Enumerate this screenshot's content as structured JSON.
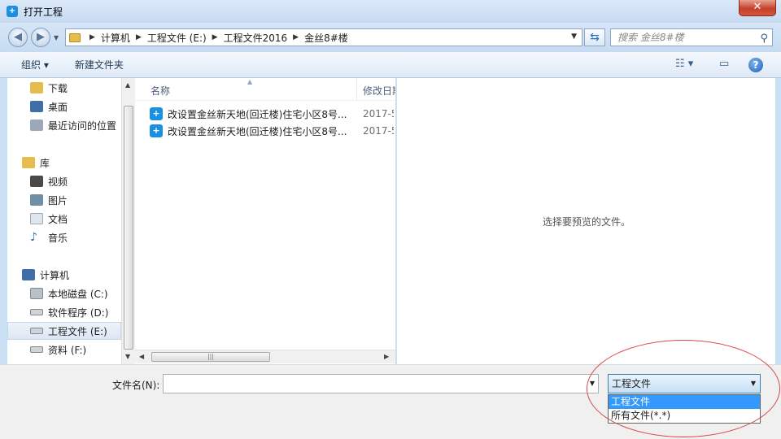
{
  "window": {
    "title": "打开工程",
    "app_icon": "app-logo-icon",
    "close_label": "✕"
  },
  "address_bar": {
    "crumbs": [
      "计算机",
      "工程文件 (E:)",
      "工程文件2016",
      "金丝8#楼"
    ],
    "search_placeholder": "搜索 金丝8#楼"
  },
  "toolbar": {
    "organize_label": "组织 ▾",
    "new_folder_label": "新建文件夹"
  },
  "nav": {
    "items": [
      {
        "label": "下载",
        "icon": "download-folder-icon"
      },
      {
        "label": "桌面",
        "icon": "desktop-icon"
      },
      {
        "label": "最近访问的位置",
        "icon": "recent-places-icon"
      },
      {
        "label": "库",
        "icon": "library-icon"
      },
      {
        "label": "视频",
        "icon": "video-icon"
      },
      {
        "label": "图片",
        "icon": "pictures-icon"
      },
      {
        "label": "文档",
        "icon": "documents-icon"
      },
      {
        "label": "音乐",
        "icon": "music-icon"
      },
      {
        "label": "计算机",
        "icon": "computer-icon"
      },
      {
        "label": "本地磁盘 (C:)",
        "icon": "system-drive-icon"
      },
      {
        "label": "软件程序 (D:)",
        "icon": "drive-icon"
      },
      {
        "label": "工程文件 (E:)",
        "icon": "drive-icon"
      },
      {
        "label": "资料 (F:)",
        "icon": "drive-icon"
      }
    ],
    "selected": "工程文件 (E:)"
  },
  "files": {
    "headers": {
      "name": "名称",
      "date": "修改日期"
    },
    "rows": [
      {
        "name": "改设置金丝新天地(回迁楼)住宅小区8号...",
        "date": "2017-5"
      },
      {
        "name": "改设置金丝新天地(回迁楼)住宅小区8号...",
        "date": "2017-5"
      }
    ]
  },
  "preview": {
    "text": "选择要预览的文件。"
  },
  "bottom": {
    "filename_label": "文件名(N):",
    "filename_value": "",
    "filetype_selected": "工程文件",
    "filetype_options": [
      "工程文件",
      "所有文件(*.*)"
    ]
  },
  "colors": {
    "accent": "#3399ff",
    "annotation": "#d84a4a",
    "file_icon": "#1d8fe0"
  }
}
